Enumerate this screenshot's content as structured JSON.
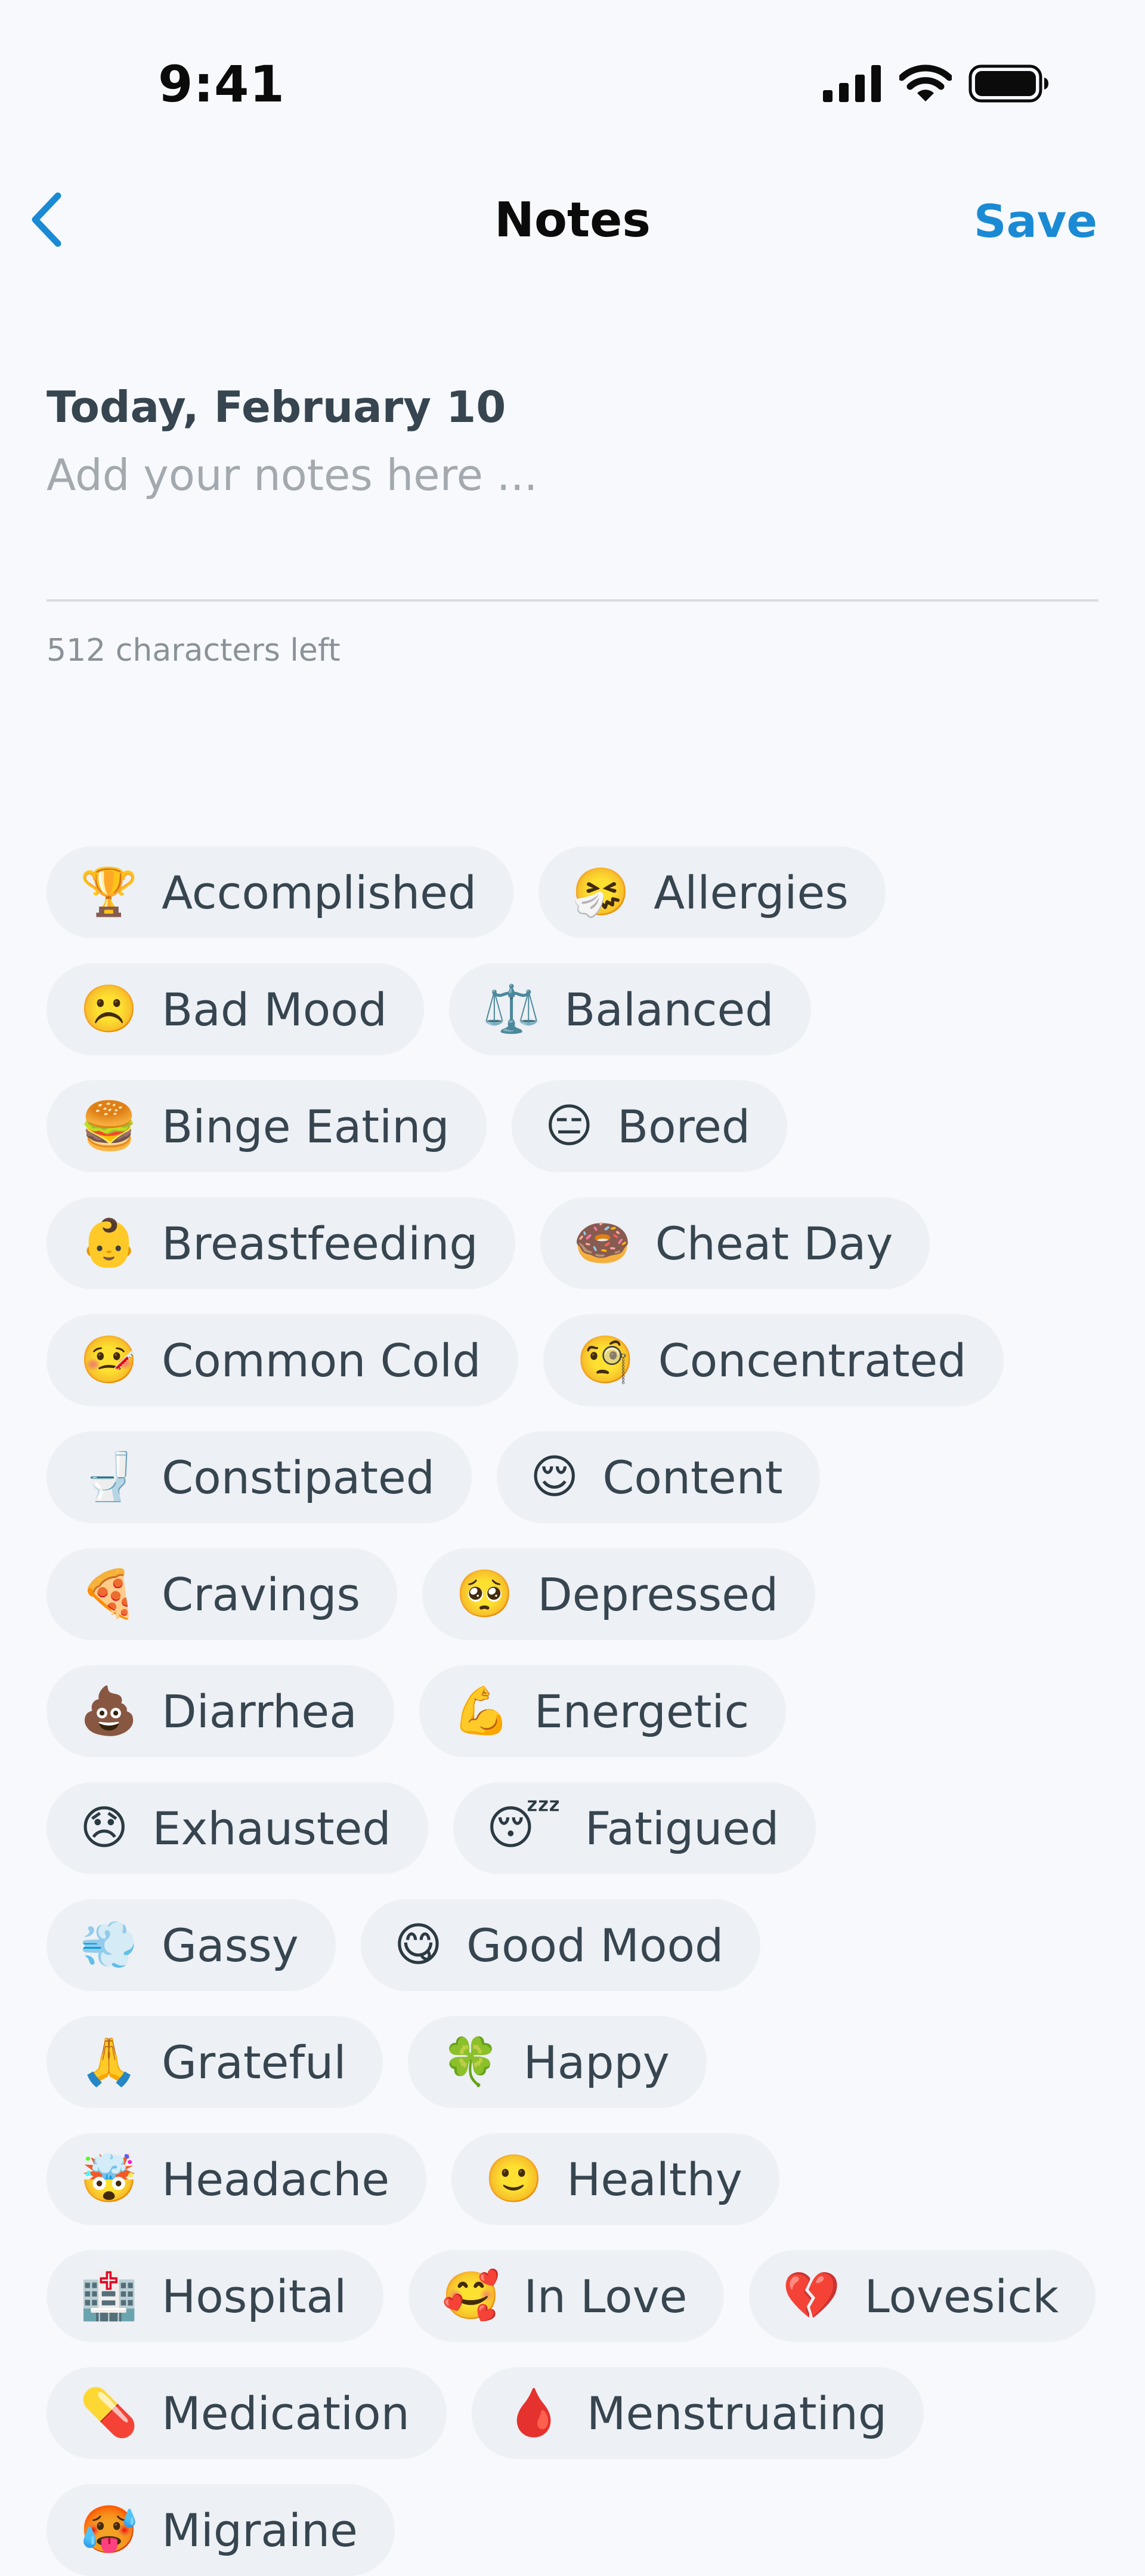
{
  "status_bar": {
    "time": "9:41"
  },
  "nav": {
    "title": "Notes",
    "save_label": "Save"
  },
  "notes": {
    "date_label": "Today, February 10",
    "placeholder": "Add your notes here ...",
    "value": "",
    "chars_left": "512 characters left"
  },
  "tags": [
    {
      "emoji": "🏆",
      "label": "Accomplished"
    },
    {
      "emoji": "🤧",
      "label": "Allergies"
    },
    {
      "emoji": "☹️",
      "label": "Bad Mood"
    },
    {
      "emoji": "⚖️",
      "label": "Balanced"
    },
    {
      "emoji": "🍔",
      "label": "Binge Eating"
    },
    {
      "emoji": "😑",
      "label": "Bored"
    },
    {
      "emoji": "👶",
      "label": "Breastfeeding"
    },
    {
      "emoji": "🍩",
      "label": "Cheat Day"
    },
    {
      "emoji": "🤒",
      "label": "Common Cold"
    },
    {
      "emoji": "🧐",
      "label": "Concentrated"
    },
    {
      "emoji": "🚽",
      "label": "Constipated"
    },
    {
      "emoji": "😌",
      "label": "Content"
    },
    {
      "emoji": "🍕",
      "label": "Cravings"
    },
    {
      "emoji": "🥺",
      "label": "Depressed"
    },
    {
      "emoji": "💩",
      "label": "Diarrhea"
    },
    {
      "emoji": "💪",
      "label": "Energetic"
    },
    {
      "emoji": "😞",
      "label": "Exhausted"
    },
    {
      "emoji": "😴",
      "label": "Fatigued"
    },
    {
      "emoji": "💨",
      "label": "Gassy"
    },
    {
      "emoji": "😋",
      "label": "Good Mood"
    },
    {
      "emoji": "🙏",
      "label": "Grateful"
    },
    {
      "emoji": "🍀",
      "label": "Happy"
    },
    {
      "emoji": "🤯",
      "label": "Headache"
    },
    {
      "emoji": "🙂",
      "label": "Healthy"
    },
    {
      "emoji": "🏥",
      "label": "Hospital"
    },
    {
      "emoji": "🥰",
      "label": "In Love"
    },
    {
      "emoji": "💔",
      "label": "Lovesick"
    },
    {
      "emoji": "💊",
      "label": "Medication"
    },
    {
      "emoji": "🩸",
      "label": "Menstruating"
    },
    {
      "emoji": "🥵",
      "label": "Migraine"
    }
  ],
  "colors": {
    "accent": "#1a8ad4",
    "background": "#f7f9fc",
    "chip": "#edf0f4",
    "text": "#36454f"
  }
}
